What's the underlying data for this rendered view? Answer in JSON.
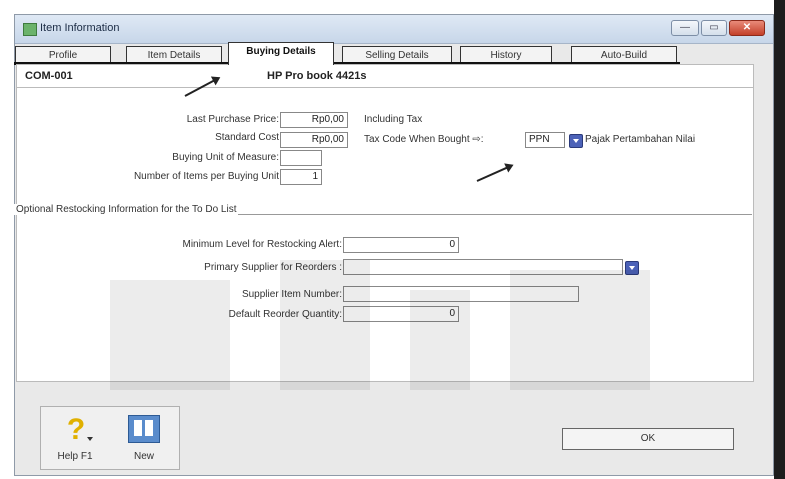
{
  "window": {
    "title": "Item Information"
  },
  "tabs": [
    {
      "label": "Profile"
    },
    {
      "label": "Item Details"
    },
    {
      "label": "Buying Details"
    },
    {
      "label": "Selling Details"
    },
    {
      "label": "History"
    },
    {
      "label": "Auto-Build"
    }
  ],
  "item": {
    "code": "COM-001",
    "name": "HP Pro book 4421s"
  },
  "buying": {
    "last_purchase_label": "Last Purchase Price:",
    "last_purchase_value": "Rp0,00",
    "including_tax": "Including Tax",
    "standard_cost_label": "Standard Cost",
    "standard_cost_value": "Rp0,00",
    "tax_code_label": "Tax Code When Bought ⇨:",
    "tax_code_value": "PPN",
    "tax_code_desc": "Pajak Pertambahan Nilai",
    "unit_label": "Buying Unit of Measure:",
    "unit_value": "",
    "items_per_unit_label": "Number of Items per Buying Unit",
    "items_per_unit_value": "1"
  },
  "restock": {
    "group_title": "Optional Restocking Information for the To Do List",
    "min_level_label": "Minimum Level for Restocking Alert:",
    "min_level_value": "0",
    "primary_supplier_label": "Primary Supplier for Reorders      :",
    "primary_supplier_value": "",
    "supplier_item_label": "Supplier Item Number:",
    "supplier_item_value": "",
    "reorder_qty_label": "Default Reorder Quantity:",
    "reorder_qty_value": "0"
  },
  "toolbar": {
    "help_label": "Help F1",
    "new_label": "New"
  },
  "ok_label": "OK"
}
